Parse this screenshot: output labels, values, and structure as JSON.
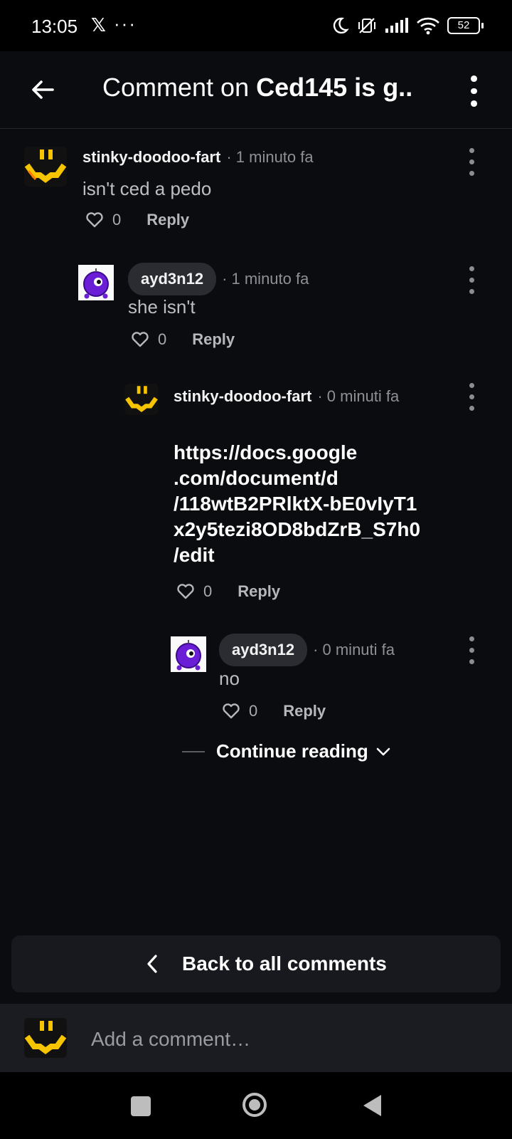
{
  "status_bar": {
    "time": "13:05",
    "x_logo": "𝕏",
    "more": "···",
    "battery": "52",
    "icons": [
      "moon-icon",
      "vibrate-off-icon",
      "signal-icon",
      "wifi-icon",
      "battery-icon"
    ]
  },
  "header": {
    "title_prefix": "Comment on ",
    "title_bold": "Ced145 is g..",
    "back_icon": "arrow-left-icon",
    "more_icon": "more-vertical-icon"
  },
  "comments": [
    {
      "username": "stinky-doodoo-fart",
      "time": "· 1 minuto fa",
      "body": "isn't ced a pedo",
      "likes": "0",
      "reply_label": "Reply",
      "avatar": "smiley-avatar"
    },
    {
      "username": "ayd3n12",
      "time": "· 1 minuto fa",
      "body": "she isn't",
      "likes": "0",
      "reply_label": "Reply",
      "avatar": "purple-bomb-avatar"
    },
    {
      "username": "stinky-doodoo-fart",
      "time": "· 0 minuti fa",
      "body_lines": [
        "https://docs.google",
        ".com/document/d",
        "/118wtB2PRlktX-bE0vIyT1",
        "x2y5tezi8OD8bdZrB_S7h0",
        "/edit"
      ],
      "likes": "0",
      "reply_label": "Reply",
      "avatar": "smiley-avatar"
    },
    {
      "username": "ayd3n12",
      "time": "· 0 minuti fa",
      "body": "no",
      "likes": "0",
      "reply_label": "Reply",
      "avatar": "purple-bomb-avatar"
    }
  ],
  "continue_reading": "Continue reading",
  "back_to_all": "Back to all comments",
  "add_comment_placeholder": "Add a comment…",
  "colors": {
    "background": "#0b0c10",
    "pill": "#2a2c31",
    "panel": "#17191e",
    "avatar_yellow": "#f7c500",
    "avatar_purple": "#6a1fd6"
  }
}
